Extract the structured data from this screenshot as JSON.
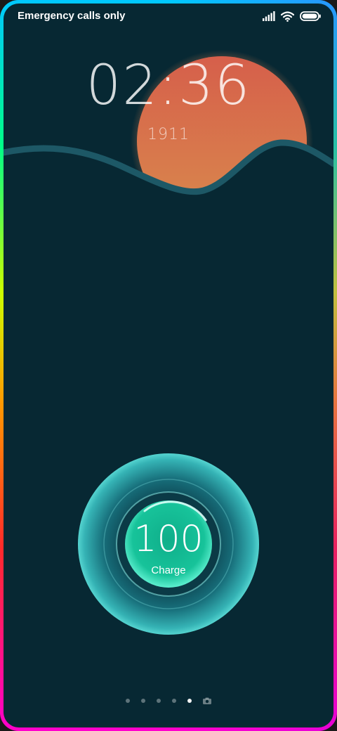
{
  "status_bar": {
    "carrier_text": "Emergency calls only",
    "icons": [
      "signal-icon",
      "wifi-icon",
      "battery-icon"
    ]
  },
  "lockscreen": {
    "time": "02:36",
    "date": "1911"
  },
  "charging": {
    "value": "100",
    "label": "Charge",
    "level_percent": 100
  },
  "pager": {
    "dot_count": 5,
    "active_index": 4,
    "trailing_icon": "camera-icon"
  },
  "colors": {
    "background": "#072833",
    "sun": "#d9694a",
    "wave": "#1d5a66",
    "charge_ring": "#2ee6c0"
  }
}
